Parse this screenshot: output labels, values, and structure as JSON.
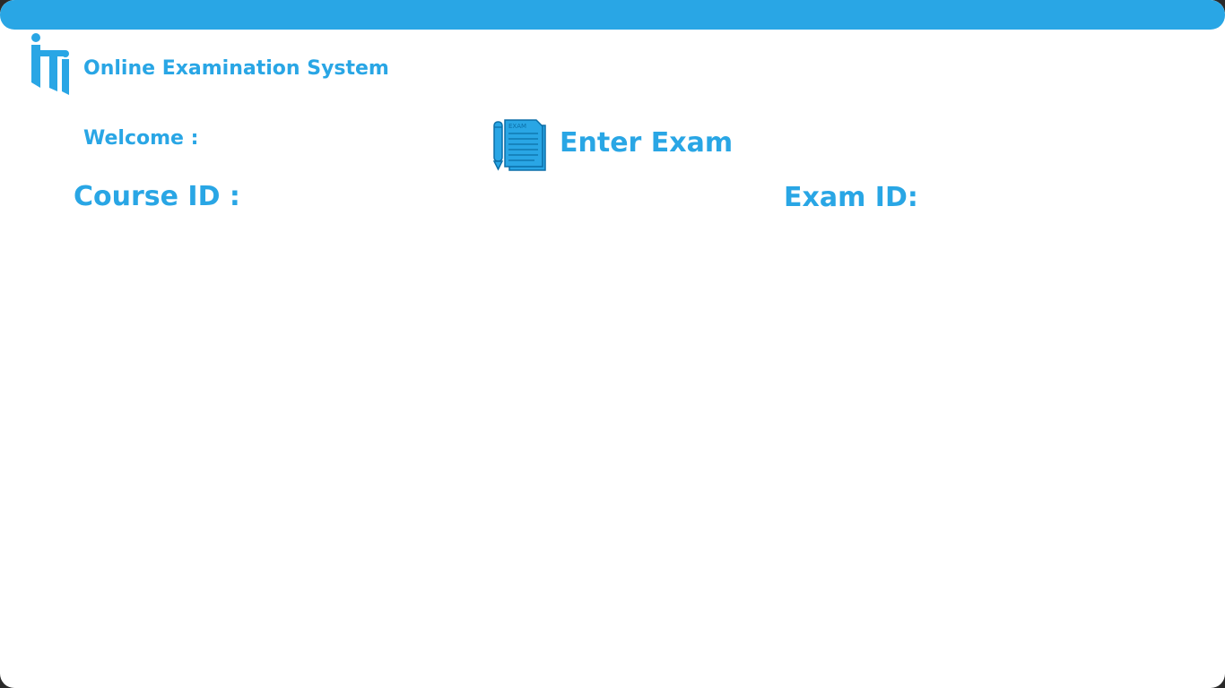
{
  "app": {
    "title": "Online Examination System",
    "logo_icon": "iti-logo-icon",
    "accent_color": "#29a6e5"
  },
  "header": {
    "welcome_label": "Welcome :"
  },
  "exam_section": {
    "icon": "exam-paper-icon",
    "icon_text": "EXAM",
    "enter_exam_label": "Enter Exam"
  },
  "form": {
    "course_id_label": "Course ID :",
    "exam_id_label": "Exam ID:"
  }
}
